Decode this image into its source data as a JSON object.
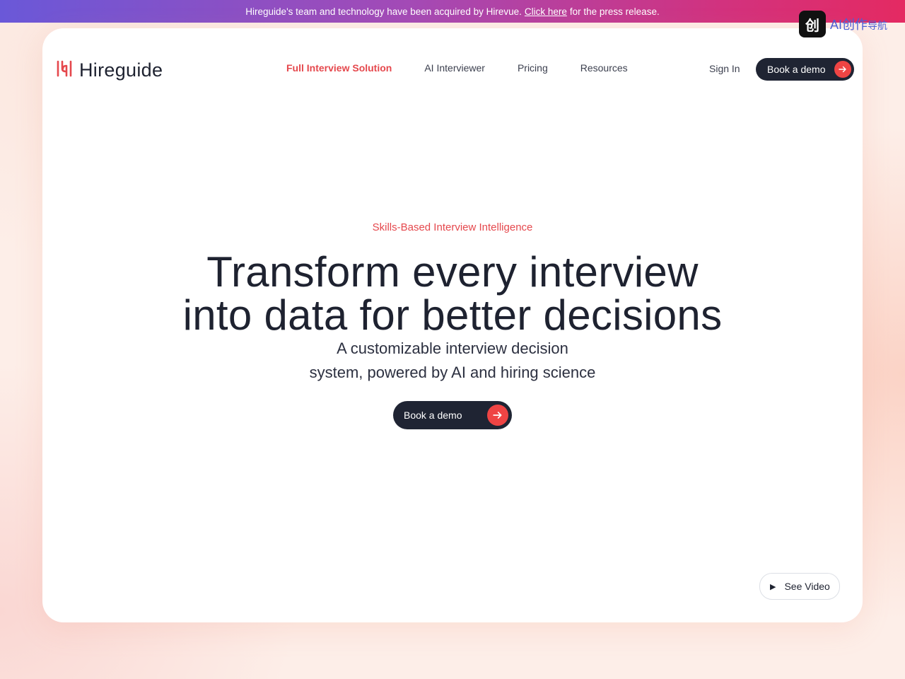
{
  "banner": {
    "text_before": "Hireguide's team and technology have been acquired by Hirevue.",
    "link": "Click here",
    "text_after": "for the press release."
  },
  "overlay_badge": {
    "logo_glyph": "创",
    "text": "AI创作",
    "text_small": "导航"
  },
  "brand": {
    "name": "Hireguide",
    "accent_color": "#e5484d"
  },
  "nav": {
    "items": [
      {
        "label": "Full Interview Solution",
        "active": true
      },
      {
        "label": "AI Interviewer",
        "active": false
      },
      {
        "label": "Pricing",
        "active": false
      },
      {
        "label": "Resources",
        "active": false
      }
    ],
    "sign_in": "Sign In",
    "cta": "Book a demo"
  },
  "hero": {
    "eyebrow": "Skills-Based Interview Intelligence",
    "headline_line1": "Transform every interview",
    "headline_line2": "into data for better decisions",
    "sub_line1": "A customizable interview decision",
    "sub_line2": "system, powered by AI and hiring science",
    "cta": "Book a demo"
  },
  "video": {
    "label": "See Video"
  }
}
